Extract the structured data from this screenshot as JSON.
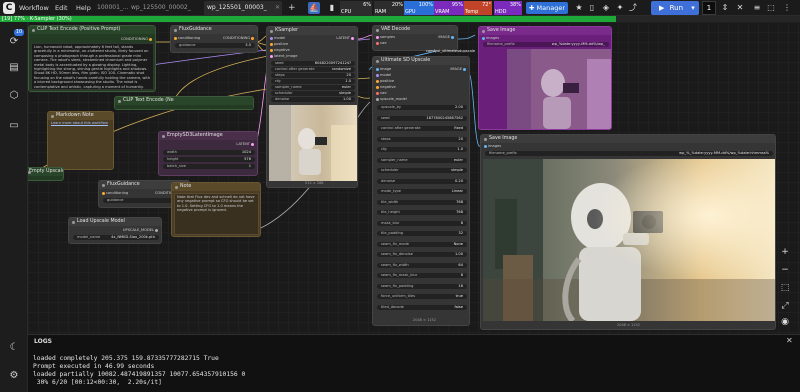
{
  "topbar": {
    "menu": [
      "Workflow",
      "Edit",
      "Help"
    ],
    "tabs": [
      {
        "label": "100001_...",
        "active": false
      },
      {
        "label": "wp_125500_00002_",
        "active": false
      },
      {
        "label": "wp_125501_00003_",
        "active": true
      }
    ],
    "add_tab": "+",
    "stats": [
      {
        "label": "CPU",
        "value": "6%",
        "color": "#2d2d2d"
      },
      {
        "label": "RAM",
        "value": "20%",
        "color": "#2d2d2d"
      },
      {
        "label": "GPU",
        "value": "100%",
        "color": "#2a6fd8"
      },
      {
        "label": "VRAM",
        "value": "95%",
        "color": "#7a2bbd"
      },
      {
        "label": "Temp",
        "value": "72°",
        "color": "#c1442a"
      },
      {
        "label": "HDD",
        "value": "38%",
        "color": "#7a2bbd"
      }
    ],
    "manager_label": "Manager",
    "run_label": "Run",
    "run_count": "1"
  },
  "progress": {
    "text": "[19] 77% · K-Sampler (30%)",
    "fraction": 0.77,
    "color": "#1fa83a"
  },
  "sidebar": {
    "queue_badge": "10"
  },
  "nodes": {
    "clip_pos": {
      "title": "CLIP Text Encode (Positive Prompt)",
      "out_label": "CONDITIONING",
      "text": "Lion, humanoid robot, approximately 6 feet tall, stands gracefully in a minimalist, un-cluttered studio, likely focused on composing a photograph through a professional grade mini camera. The robot's sleek, streamlined chromium and polymer metal body is accentuated by a glowing display. Lighting, highlighting the strong, shining gentle highlights and shadows. Shoot 8K HD, 50mm lens, film grain. ISO 100. Cinematic shot focusing on the robot's hands carefully holding the camera, with a blurred background showcasing the studio. The robot is contemplative and artistic, capturing a moment of humanity."
    },
    "flux_guidance_1": {
      "title": "FluxGuidance",
      "in_label": "conditioning",
      "out_label": "CONDITIONING",
      "w_label": "guidance",
      "w_value": "3.5"
    },
    "clip_neg": {
      "title": "CLIP Text Encode (Ne",
      "out_label": "CONDITIONING"
    },
    "markdown_note": {
      "title": "Markdown Note",
      "text": "Learn more about this workflow"
    },
    "empty_latent": {
      "title": "EmptySD3LatentImage",
      "out_label": "LATENT",
      "widgets": [
        {
          "label": "width",
          "value": "1024"
        },
        {
          "label": "height",
          "value": "576"
        },
        {
          "label": "batch_size",
          "value": "1"
        }
      ]
    },
    "flux_guidance_2": {
      "title": "FluxGuidance",
      "in_label": "conditioning",
      "out_label": "CONDITIONING",
      "w_label": "guidance",
      "w_value": "3.5"
    },
    "empty_prompt": {
      "title": "Empty Upscale Prompt"
    },
    "load_upscale": {
      "title": "Load Upscale Model",
      "out_label": "UPSCALE_MODEL",
      "w_label": "model_name",
      "w_value": "4x_NMKD-Siax_200k.pth"
    },
    "note": {
      "title": "Note",
      "text": "Note that Flux dev and schnell do not have any negative prompt so CFG should be set to 1.0. Setting CFG to 1.0 means the negative prompt is ignored."
    },
    "ksampler": {
      "title": "KSampler",
      "inputs": [
        "model",
        "positive",
        "negative",
        "latent_image"
      ],
      "out_label": "LATENT",
      "widgets": [
        {
          "label": "seed",
          "value": "604822009724124?"
        },
        {
          "label": "control after generate",
          "value": "randomize"
        },
        {
          "label": "steps",
          "value": "20"
        },
        {
          "label": "cfg",
          "value": "1.0"
        },
        {
          "label": "sampler_name",
          "value": "euler"
        },
        {
          "label": "scheduler",
          "value": "simple"
        },
        {
          "label": "denoise",
          "value": "1.00"
        }
      ],
      "footer": "512 × 288"
    },
    "vae_decode": {
      "title": "VAE Decode",
      "inputs": [
        "samples",
        "vae"
      ],
      "out_label": "IMAGE"
    },
    "ultimate_upscale": {
      "title": "Ultimate SD Upscale",
      "header_label": "comfyui_ultimatesdupscale",
      "inputs": [
        "image",
        "model",
        "positive",
        "negative",
        "vae",
        "upscale_model"
      ],
      "out_label": "IMAGE",
      "widgets": [
        {
          "label": "upscale_by",
          "value": "2.00"
        },
        {
          "label": "seed",
          "value": "1877800245867562"
        },
        {
          "label": "control after generate",
          "value": "fixed"
        },
        {
          "label": "steps",
          "value": "20"
        },
        {
          "label": "cfg",
          "value": "1.0"
        },
        {
          "label": "sampler_name",
          "value": "euler"
        },
        {
          "label": "scheduler",
          "value": "simple"
        },
        {
          "label": "denoise",
          "value": "0.20"
        },
        {
          "label": "mode_type",
          "value": "Linear"
        },
        {
          "label": "tile_width",
          "value": "768"
        },
        {
          "label": "tile_height",
          "value": "768"
        },
        {
          "label": "mask_blur",
          "value": "8"
        },
        {
          "label": "tile_padding",
          "value": "32"
        },
        {
          "label": "seam_fix_mode",
          "value": "None"
        },
        {
          "label": "seam_fix_denoise",
          "value": "1.00"
        },
        {
          "label": "seam_fix_width",
          "value": "64"
        },
        {
          "label": "seam_fix_mask_blur",
          "value": "8"
        },
        {
          "label": "seam_fix_padding",
          "value": "16"
        },
        {
          "label": "force_uniform_tiles",
          "value": "true"
        },
        {
          "label": "tiled_decode",
          "value": "false"
        }
      ],
      "footer": "2048 × 1152"
    },
    "save_image": {
      "title": "Save Image",
      "in_label": "images",
      "w_label": "filename_prefix",
      "w_value": "wp_%_%date:yyyy-MM-dd%/wp_%date:hhmmss%",
      "footer": "2048 × 1152"
    },
    "preview_top": {
      "title": "Save Image",
      "in_label": "images",
      "w_label": "filename_prefix",
      "w_value": "wp_%date:yyyy-MM-dd%/wp_"
    }
  },
  "logs": {
    "title": "LOGS",
    "close": "✕",
    "lines": [
      "loaded completely 205.375 159.87335777282715 True",
      "Prompt executed in 46.99 seconds",
      "loaded partially 10082.487419891357 10077.654357910156 0",
      " 30% 6/20 [00:12<00:30,  2.20s/it]"
    ]
  }
}
